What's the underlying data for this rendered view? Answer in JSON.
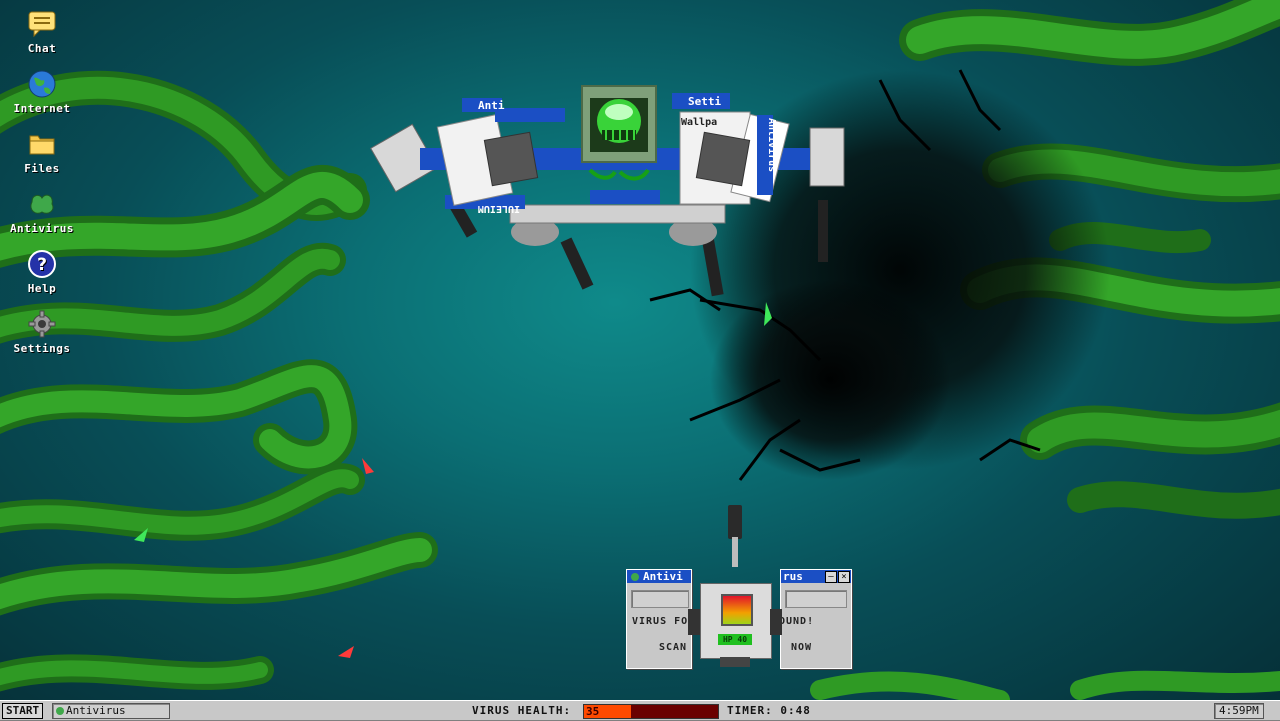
{
  "desktop": {
    "icons": [
      {
        "label": "Chat",
        "icon": "chat-bubble-icon"
      },
      {
        "label": "Internet",
        "icon": "globe-icon"
      },
      {
        "label": "Files",
        "icon": "folder-icon"
      },
      {
        "label": "Antivirus",
        "icon": "antivirus-blob-icon"
      },
      {
        "label": "Help",
        "icon": "help-question-icon"
      },
      {
        "label": "Settings",
        "icon": "gear-icon"
      }
    ]
  },
  "boss": {
    "window_titles": [
      "Anti",
      "Setti",
      "Wallpa",
      "Antivirus"
    ],
    "hud_score": "IULEIUM"
  },
  "player": {
    "left_window_title": "Antivi",
    "right_window_title": "rus",
    "left_text": "VIRUS FO",
    "right_text": "OUND!",
    "left_button": "SCAN",
    "right_button": "NOW",
    "hp_label": "HP 40",
    "hp_value": 40
  },
  "taskbar": {
    "start_label": "START",
    "task_label": "Antivirus",
    "virus_health_label": "VIRUS HEALTH:",
    "virus_health_value": "35",
    "virus_health_fraction": 0.35,
    "timer_label": "TIMER: 0:48",
    "clock": "4:59PM"
  },
  "colors": {
    "accent_blue": "#1b4fc4",
    "vine_green": "#2f9a24",
    "health_fill": "#ff4a00",
    "health_track": "#6a0000"
  }
}
